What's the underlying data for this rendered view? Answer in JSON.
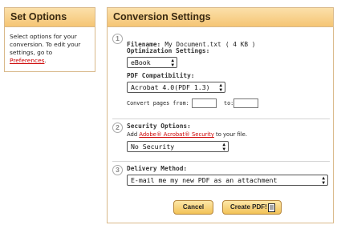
{
  "left_panel": {
    "title": "Set Options",
    "desc_before": "Select options for your conversion. To edit your settings, go to ",
    "desc_link": "Preferences",
    "desc_after": "."
  },
  "right_panel": {
    "title": "Conversion Settings",
    "section1": {
      "number": "1",
      "filename_label": "Filename:",
      "filename_value": "My Document.txt",
      "file_size": "( 4 KB )",
      "optimization_label": "Optimization Settings:",
      "optimization_value": "eBook",
      "compat_label": "PDF Compatibility:",
      "compat_value": "Acrobat 4.0(PDF 1.3)",
      "pages_from_label": "Convert pages from:",
      "pages_to_label": "to:",
      "pages_from_value": "",
      "pages_to_value": ""
    },
    "section2": {
      "number": "2",
      "label": "Security Options:",
      "help_before": "Add ",
      "help_link": "Adobe® Acrobat® Security",
      "help_after": " to your file.",
      "value": "No Security"
    },
    "section3": {
      "number": "3",
      "label": "Delivery Method:",
      "value": "E-mail me my new PDF as an attachment"
    },
    "buttons": {
      "cancel": "Cancel",
      "create": "Create PDF!"
    }
  },
  "colors": {
    "header_top": "#fbe0aa",
    "header_bottom": "#f5c574",
    "border": "#d9b98a",
    "link": "#cc0000",
    "button_border": "#b6863b"
  }
}
